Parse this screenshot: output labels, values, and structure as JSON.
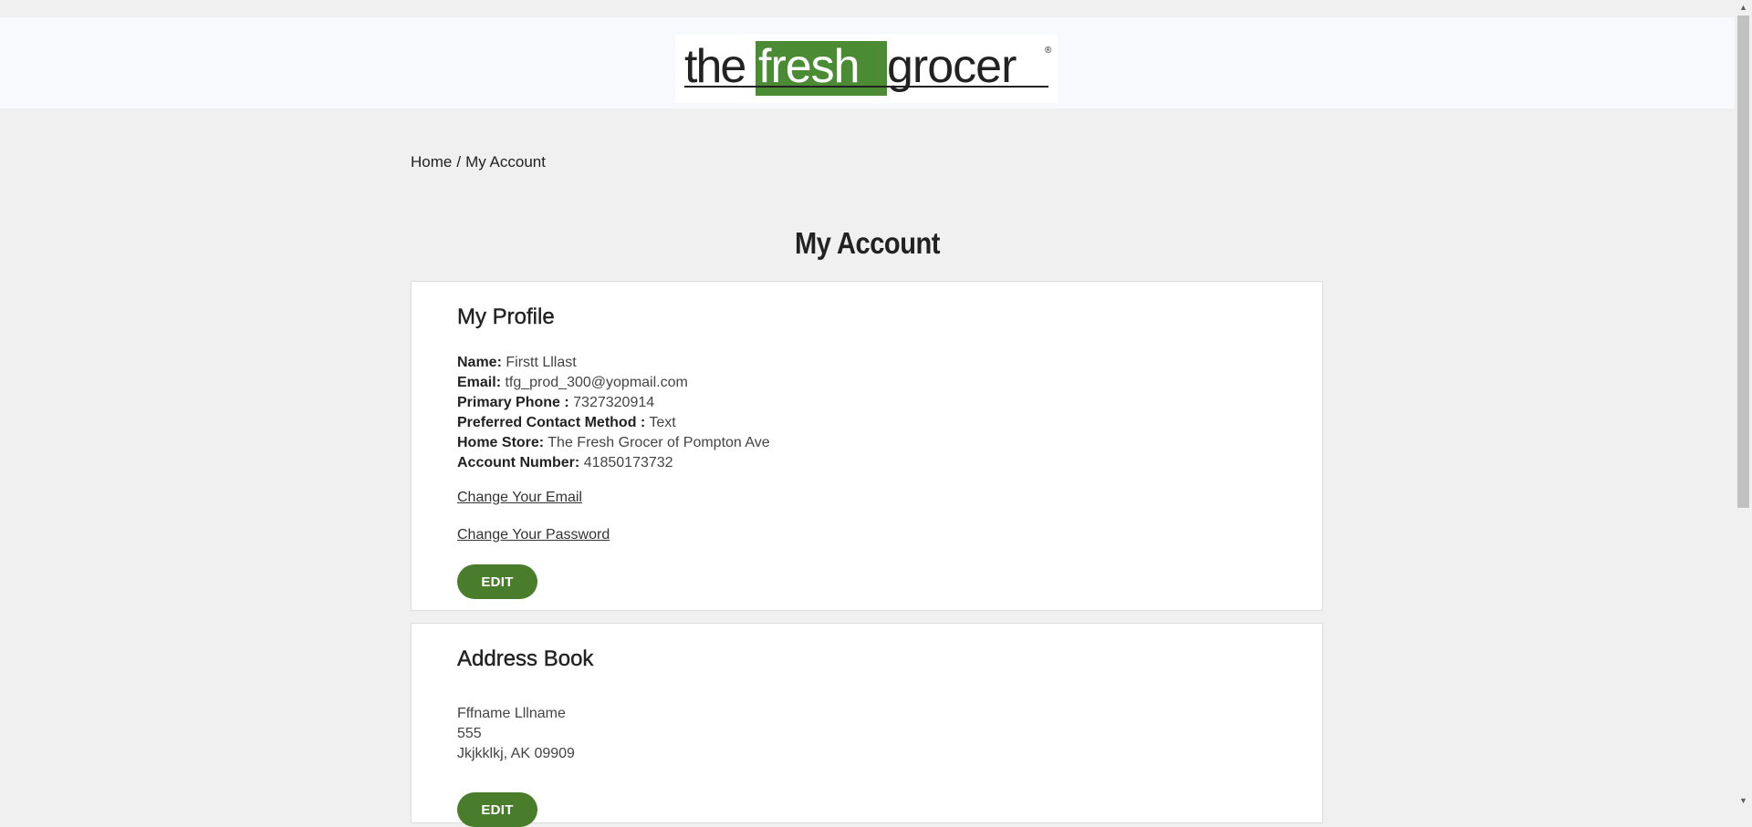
{
  "brand": {
    "logo_text_the": "the",
    "logo_text_fresh": "fresh",
    "logo_text_grocer": "grocer",
    "logo_mark": "®",
    "accent_color": "#4a8b34",
    "button_color": "#4a7d2b"
  },
  "breadcrumb": {
    "home": "Home",
    "separator": "/",
    "current": "My Account"
  },
  "page_title": "My Account",
  "profile": {
    "heading": "My Profile",
    "name_label": "Name:",
    "name_value": "Firstt Lllast",
    "email_label": "Email:",
    "email_value": "tfg_prod_300@yopmail.com",
    "phone_label": "Primary Phone :",
    "phone_value": "7327320914",
    "contact_label": "Preferred Contact Method :",
    "contact_value": "Text",
    "store_label": "Home Store:",
    "store_value": "The Fresh Grocer of Pompton Ave",
    "account_label": "Account Number:",
    "account_value": "41850173732",
    "change_email": "Change Your Email",
    "change_password": "Change Your Password",
    "edit_label": "EDIT"
  },
  "address_book": {
    "heading": "Address Book",
    "name": "Fffname Lllname",
    "line1": "555",
    "city_state_zip": "Jkjkklkj, AK 09909",
    "edit_label": "EDIT"
  },
  "icons": {
    "scroll_up": "scroll-up-arrow-icon",
    "scroll_down": "scroll-down-arrow-icon"
  }
}
